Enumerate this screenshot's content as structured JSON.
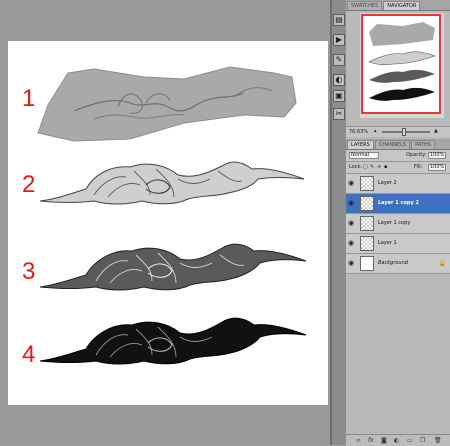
{
  "steps": [
    "1",
    "2",
    "3",
    "4"
  ],
  "panel_tabs_top": [
    "SWATCHES",
    "NAVIGATOR"
  ],
  "navigator": {
    "zoom": "76.63%"
  },
  "panel_tabs_layers": [
    "LAYERS",
    "CHANNELS",
    "PATHS"
  ],
  "layer_options": {
    "blend_mode": "Normal",
    "opacity_label": "Opacity:",
    "opacity_value": "100%",
    "lock_label": "Lock:",
    "fill_label": "Fill:",
    "fill_value": "100%"
  },
  "layers": [
    {
      "name": "Layer 2",
      "selected": false
    },
    {
      "name": "Layer 1 copy 2",
      "selected": true
    },
    {
      "name": "Layer 1 copy",
      "selected": false
    },
    {
      "name": "Layer 1",
      "selected": false
    },
    {
      "name": "Background",
      "selected": false
    }
  ],
  "tools": [
    "history-icon",
    "actions-icon",
    "brush-icon",
    "color-icon",
    "styles-icon",
    "tool-presets-icon"
  ],
  "bottom_icons": [
    "link-icon",
    "fx-icon",
    "mask-icon",
    "adjustment-icon",
    "folder-icon",
    "new-layer-icon",
    "trash-icon"
  ]
}
